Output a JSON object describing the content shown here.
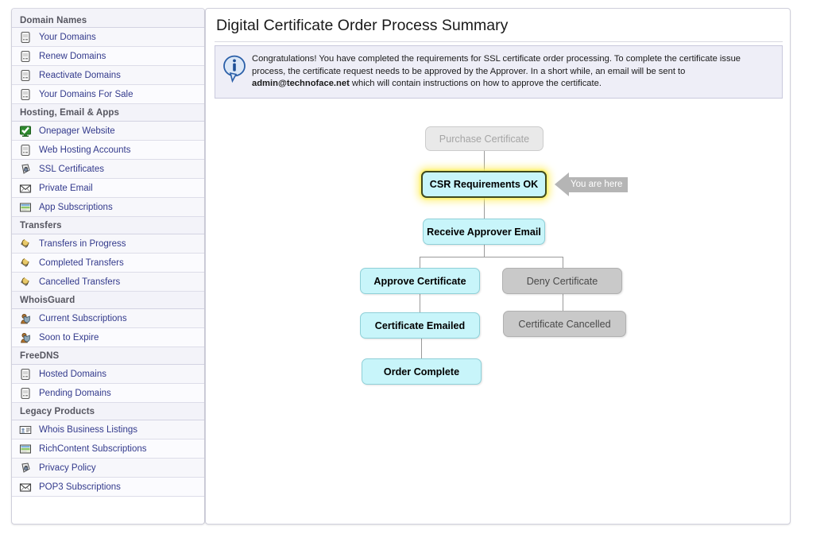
{
  "sidebar": {
    "groups": [
      {
        "title": "Domain Names",
        "items": [
          {
            "label": "Your Domains",
            "icon": "document-icon"
          },
          {
            "label": "Renew Domains",
            "icon": "document-icon"
          },
          {
            "label": "Reactivate Domains",
            "icon": "document-icon"
          },
          {
            "label": "Your Domains For Sale",
            "icon": "document-icon"
          }
        ]
      },
      {
        "title": "Hosting, Email & Apps",
        "items": [
          {
            "label": "Onepager Website",
            "icon": "green-check-monitor-icon"
          },
          {
            "label": "Web Hosting Accounts",
            "icon": "document-icon"
          },
          {
            "label": "SSL Certificates",
            "icon": "padlock-tag-icon"
          },
          {
            "label": "Private Email",
            "icon": "envelope-icon"
          },
          {
            "label": "App Subscriptions",
            "icon": "app-window-icon"
          }
        ]
      },
      {
        "title": "Transfers",
        "items": [
          {
            "label": "Transfers in Progress",
            "icon": "transfer-arrows-icon"
          },
          {
            "label": "Completed Transfers",
            "icon": "transfer-arrows-icon"
          },
          {
            "label": "Cancelled Transfers",
            "icon": "transfer-arrows-icon"
          }
        ]
      },
      {
        "title": "WhoisGuard",
        "items": [
          {
            "label": "Current Subscriptions",
            "icon": "guard-person-icon"
          },
          {
            "label": "Soon to Expire",
            "icon": "guard-person-icon"
          }
        ]
      },
      {
        "title": "FreeDNS",
        "items": [
          {
            "label": "Hosted Domains",
            "icon": "document-icon"
          },
          {
            "label": "Pending Domains",
            "icon": "document-icon"
          }
        ]
      },
      {
        "title": "Legacy Products",
        "items": [
          {
            "label": "Whois Business Listings",
            "icon": "business-card-icon"
          },
          {
            "label": "RichContent Subscriptions",
            "icon": "app-window-icon"
          },
          {
            "label": "Privacy Policy",
            "icon": "padlock-tag-icon"
          },
          {
            "label": "POP3 Subscriptions",
            "icon": "envelope-icon"
          }
        ]
      }
    ]
  },
  "main": {
    "title": "Digital Certificate Order Process Summary",
    "info": {
      "icon": "info-bubble-icon",
      "text_part1": "Congratulations! You have completed the requirements for SSL certificate order processing. To complete the certificate issue process, the certificate request needs to be approved by the Approver. In a short while, an email will be sent to ",
      "email": "admin@technoface.net",
      "text_part2": " which will contain instructions on how to approve the certificate."
    }
  },
  "flowchart": {
    "marker": {
      "label": "You are here"
    },
    "nodes": [
      {
        "id": "purchase",
        "label": "Purchase Certificate",
        "state": "ghost"
      },
      {
        "id": "csr",
        "label": "CSR Requirements OK",
        "state": "current"
      },
      {
        "id": "approver",
        "label": "Receive Approver Email",
        "state": "cyan"
      },
      {
        "id": "approve",
        "label": "Approve Certificate",
        "state": "cyan"
      },
      {
        "id": "deny",
        "label": "Deny Certificate",
        "state": "gray"
      },
      {
        "id": "emailed",
        "label": "Certificate Emailed",
        "state": "cyan"
      },
      {
        "id": "cancelled",
        "label": "Certificate Cancelled",
        "state": "gray"
      },
      {
        "id": "complete",
        "label": "Order Complete",
        "state": "cyan"
      }
    ]
  },
  "colors": {
    "node_active": "#c8f5fa",
    "node_inactive": "#c9c9c9",
    "node_ghost": "#e9e9e9",
    "current_glow": "#ffeb3c",
    "link_text": "#333a8c",
    "info_bg": "#eeeef7",
    "marker_gray": "#b5b5b5"
  }
}
